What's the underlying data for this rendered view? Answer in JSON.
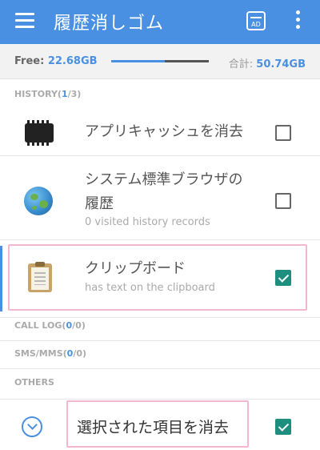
{
  "app": {
    "title": "履歴消しゴム"
  },
  "icons": {
    "menu": "menu-icon",
    "ad": "ad-free-icon",
    "more": "more-vert-icon"
  },
  "storage": {
    "free_label": "Free: ",
    "free_value": "22.68GB",
    "total_label": "合計: ",
    "total_value": "50.74GB",
    "used_fraction": 0.55
  },
  "sections": {
    "history": {
      "prefix": "HISTORY(",
      "selected": "1",
      "sep": "/",
      "total": "3",
      "suffix": ")"
    },
    "call_log": {
      "prefix": "CALL LOG(",
      "selected": "0",
      "sep": "/",
      "total": "0",
      "suffix": ")"
    },
    "sms": {
      "prefix": "SMS/MMS(",
      "selected": "0",
      "sep": "/",
      "total": "0",
      "suffix": ")"
    },
    "others": {
      "label": "OTHERS"
    }
  },
  "items": [
    {
      "title": "アプリキャッシュを消去",
      "subtitle": "",
      "checked": false,
      "icon": "chip-icon"
    },
    {
      "title_line1": "システム標準ブラウザの",
      "title_line2": "履歴",
      "subtitle": "0 visited history records",
      "checked": false,
      "icon": "globe-icon"
    },
    {
      "title": "クリップボード",
      "subtitle": "has text on the clipboard",
      "checked": true,
      "icon": "clipboard-icon"
    }
  ],
  "footer": {
    "delete_label": "選択された項目を消去",
    "checked": true,
    "icon": "chevron-down-circle-icon"
  },
  "colors": {
    "primary": "#4a90e2",
    "check": "#1e8f7e",
    "highlight": "#f4b7cf"
  }
}
